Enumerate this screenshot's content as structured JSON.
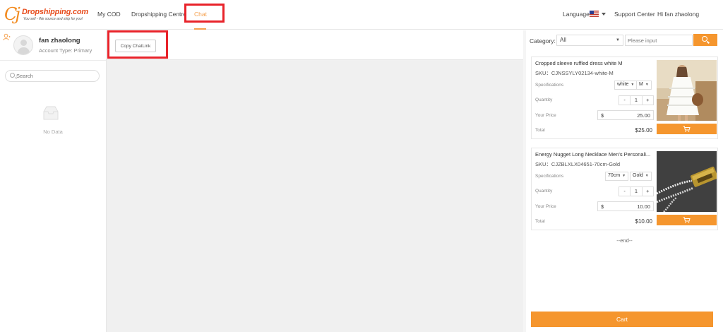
{
  "logo": {
    "brand": "Dropshipping.com",
    "tagline": "You sell - We source and ship for you!"
  },
  "nav": {
    "items": [
      {
        "label": "My COD"
      },
      {
        "label": "Dropshipping Centre"
      },
      {
        "label": "Chat",
        "active": true
      }
    ]
  },
  "header_right": {
    "language_label": "Language",
    "support": "Support Center",
    "greeting": "Hi fan zhaolong",
    "flag": "us-flag-icon"
  },
  "sidebar": {
    "user_name": "fan zhaolong",
    "account_type": "Account Type: Primary",
    "search_placeholder": "Search",
    "empty_text": "No Data"
  },
  "chat": {
    "copy_button": "Copy ChatLink"
  },
  "products_panel": {
    "category_label": "Category:",
    "category_value": "All",
    "search_placeholder": "Please input",
    "labels": {
      "specifications": "Specifications",
      "quantity": "Quantity",
      "your_price": "Your Price",
      "total": "Total",
      "currency": "$"
    },
    "products": [
      {
        "title": "Cropped sleeve ruffled dress white M",
        "sku": "SKU：CJNSSYLY02134-white-M",
        "spec1": "white",
        "spec2": "M",
        "qty_minus": "-",
        "qty": "1",
        "qty_plus": "+",
        "price": "25.00",
        "total": "$25.00"
      },
      {
        "title": "Energy Nugget Long Necklace Men's Personali...",
        "sku": "SKU：CJZBLXLX04651-70cm-Gold",
        "spec1": "70cm",
        "spec2": "Gold",
        "qty_minus": "-",
        "qty": "1",
        "qty_plus": "+",
        "price": "10.00",
        "total": "$10.00"
      }
    ],
    "end_text": "--end--",
    "cart_button": "Cart"
  },
  "colors": {
    "accent": "#f5962e",
    "highlight": "#e8232a",
    "active_nav": "#f5a14f"
  }
}
